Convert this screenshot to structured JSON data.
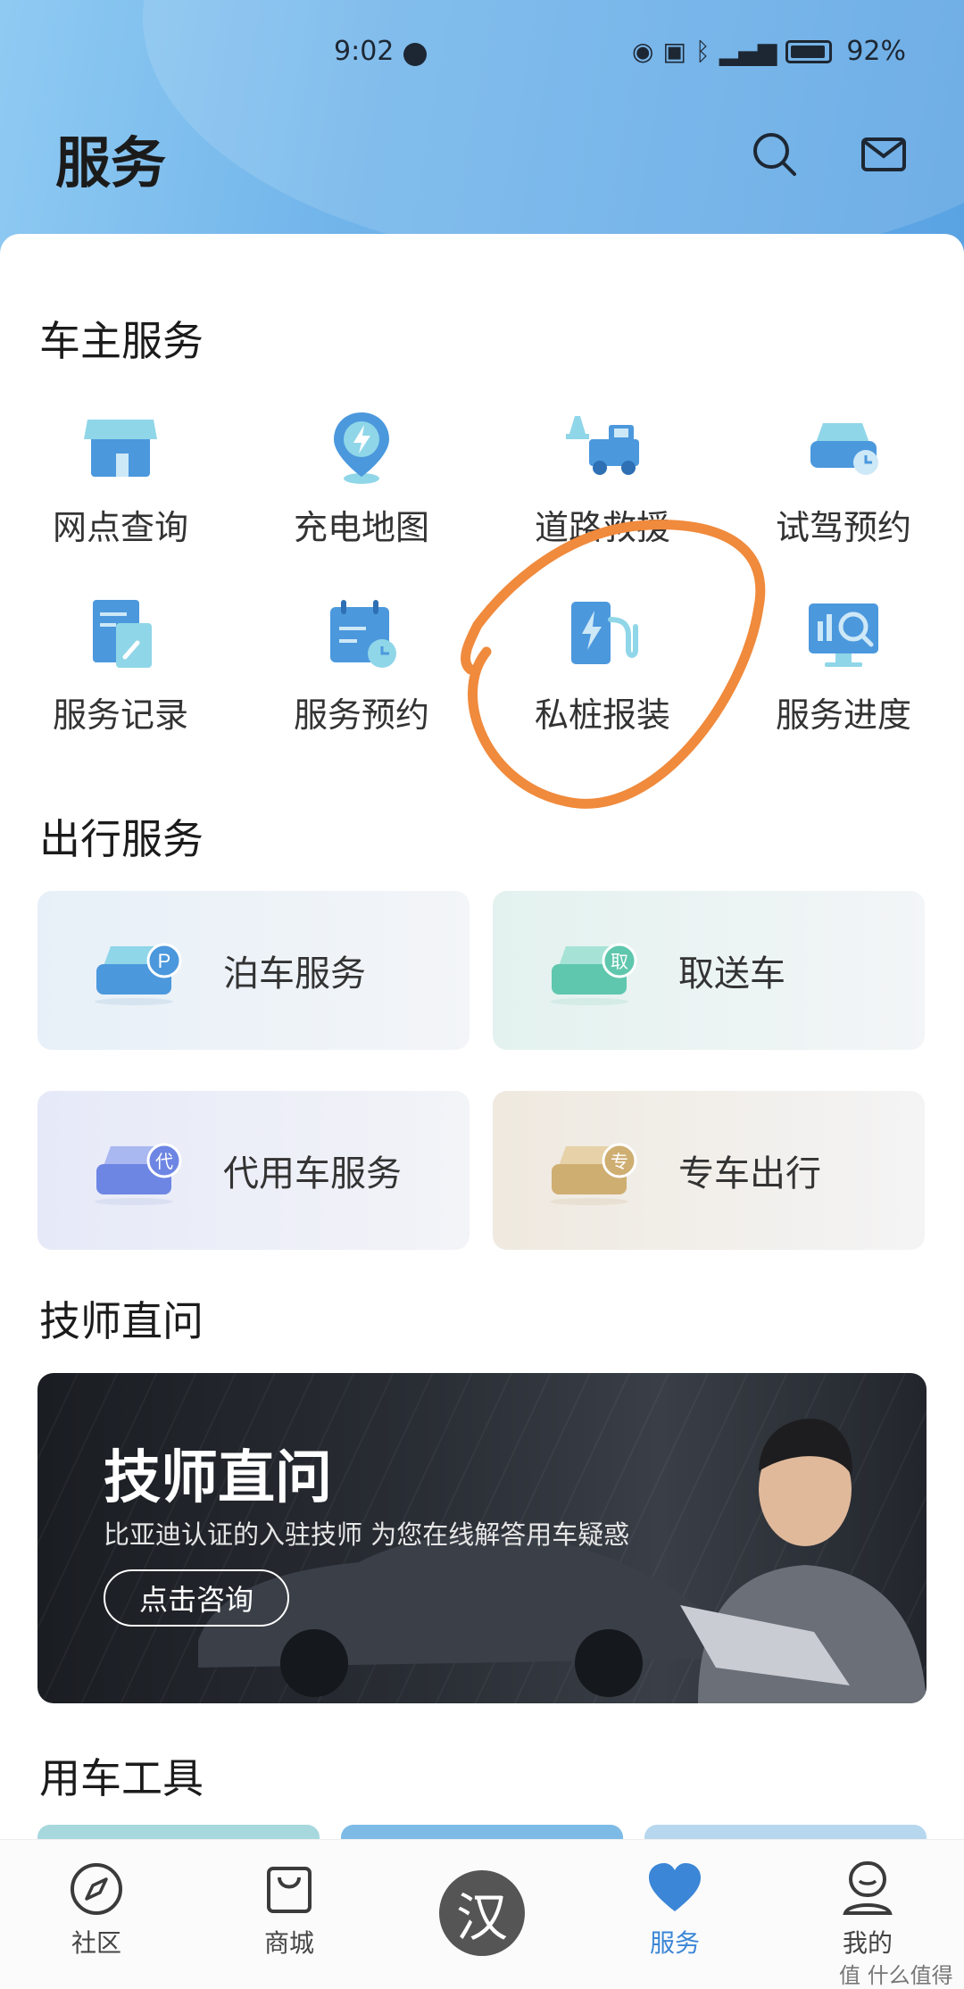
{
  "status_bar": {
    "time": "9:02",
    "battery": "92%",
    "icons": [
      "eye-icon",
      "nfc-icon",
      "bluetooth-icon",
      "5g-signal-icon",
      "battery-icon"
    ]
  },
  "header": {
    "title": "服务",
    "icons": [
      "search-icon",
      "mail-icon"
    ]
  },
  "owner_services": {
    "title": "车主服务",
    "items": [
      {
        "label": "网点查询",
        "icon": "store-icon"
      },
      {
        "label": "充电地图",
        "icon": "charging-map-icon"
      },
      {
        "label": "道路救援",
        "icon": "tow-truck-icon"
      },
      {
        "label": "试驾预约",
        "icon": "test-drive-icon"
      },
      {
        "label": "服务记录",
        "icon": "service-record-icon"
      },
      {
        "label": "服务预约",
        "icon": "calendar-icon"
      },
      {
        "label": "私桩报装",
        "icon": "charging-pile-icon"
      },
      {
        "label": "服务进度",
        "icon": "progress-monitor-icon"
      }
    ]
  },
  "travel_services": {
    "title": "出行服务",
    "items": [
      {
        "label": "泊车服务",
        "badge": "P",
        "icon": "parking-car-icon"
      },
      {
        "label": "取送车",
        "badge": "取",
        "icon": "pickup-car-icon"
      },
      {
        "label": "代用车服务",
        "badge": "代",
        "icon": "substitute-car-icon"
      },
      {
        "label": "专车出行",
        "badge": "专",
        "icon": "chauffeur-car-icon"
      }
    ]
  },
  "technician": {
    "title": "技师直问",
    "banner_title": "技师直问",
    "banner_subtitle": "比亚迪认证的入驻技师  为您在线解答用车疑惑",
    "banner_button": "点击咨询"
  },
  "tools": {
    "title": "用车工具"
  },
  "tabbar": {
    "items": [
      {
        "label": "社区",
        "icon": "compass-icon"
      },
      {
        "label": "商城",
        "icon": "shopping-bag-icon"
      },
      {
        "label": "",
        "icon": "han-logo-icon",
        "glyph": "汉"
      },
      {
        "label": "服务",
        "icon": "heart-icon",
        "active": true
      },
      {
        "label": "我的",
        "icon": "profile-icon"
      }
    ]
  },
  "watermark": "值 什么值得买",
  "colors": {
    "accent": "#3b86d6",
    "icon_blue": "#3d8fd9",
    "annotation": "#f08a3c"
  }
}
